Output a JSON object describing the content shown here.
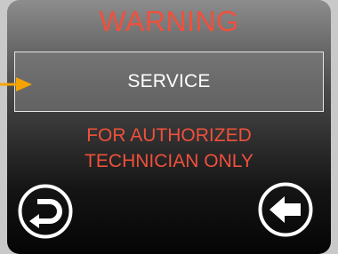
{
  "screen": {
    "title": "WARNING",
    "menu": {
      "item_label": "SERVICE"
    },
    "warning_lines": [
      "FOR AUTHORIZED",
      "TECHNICIAN ONLY"
    ],
    "buttons": {
      "back_icon": "return-icon",
      "left_icon": "arrow-left-icon"
    }
  },
  "colors": {
    "warning_red": "#f0503c",
    "pointer_yellow": "#f5a300",
    "text_white": "#ffffff"
  }
}
